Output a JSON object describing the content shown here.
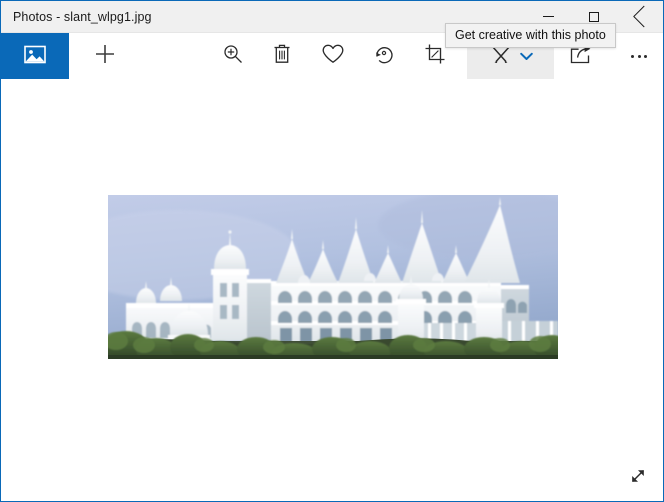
{
  "window": {
    "title": "Photos - slant_wlpg1.jpg",
    "app_name": "Photos",
    "file_name": "slant_wlpg1.jpg",
    "accent_color": "#0a69b8",
    "titlebar_color": "#f0f0f0"
  },
  "caption_buttons": [
    {
      "name": "minimize",
      "label": "Minimize",
      "glyph": "minimize-icon"
    },
    {
      "name": "maximize",
      "label": "Maximize",
      "glyph": "maximize-icon"
    },
    {
      "name": "close",
      "label": "Close",
      "glyph": "close-icon"
    }
  ],
  "toolbar": {
    "collection": {
      "label": "Collection",
      "icon": "picture-icon"
    },
    "new": {
      "label": "New",
      "icon": "plus-icon"
    },
    "zoom": {
      "label": "Zoom",
      "icon": "zoom-in-icon"
    },
    "delete": {
      "label": "Delete",
      "icon": "trash-icon"
    },
    "favorite": {
      "label": "Add to Favorites",
      "icon": "heart-icon"
    },
    "rotate": {
      "label": "Rotate",
      "icon": "rotate-icon"
    },
    "crop": {
      "label": "Crop and rotate",
      "icon": "crop-icon"
    },
    "creative": {
      "label": "Get creative with this photo",
      "icon": "pencil-brush-icon",
      "chevron": "chevron-down-icon",
      "chevron_color": "#0a69b8",
      "state": "hovered"
    },
    "share": {
      "label": "Share",
      "icon": "share-icon"
    },
    "see_more": {
      "label": "See more",
      "icon": "ellipsis-icon"
    }
  },
  "tooltip": {
    "text": "Get creative with this photo",
    "visible": true
  },
  "viewer": {
    "fit_button": {
      "label": "Full screen",
      "icon": "diagonal-arrows-icon"
    }
  },
  "photo": {
    "alt": "White palace building with spires and domes against a pale blue sky, green foliage in the foreground",
    "sky_color": "#b9c5e3",
    "building_color": "#f4f6f8",
    "foliage_color": "#44632f",
    "ground_color": "#3a4a33"
  }
}
